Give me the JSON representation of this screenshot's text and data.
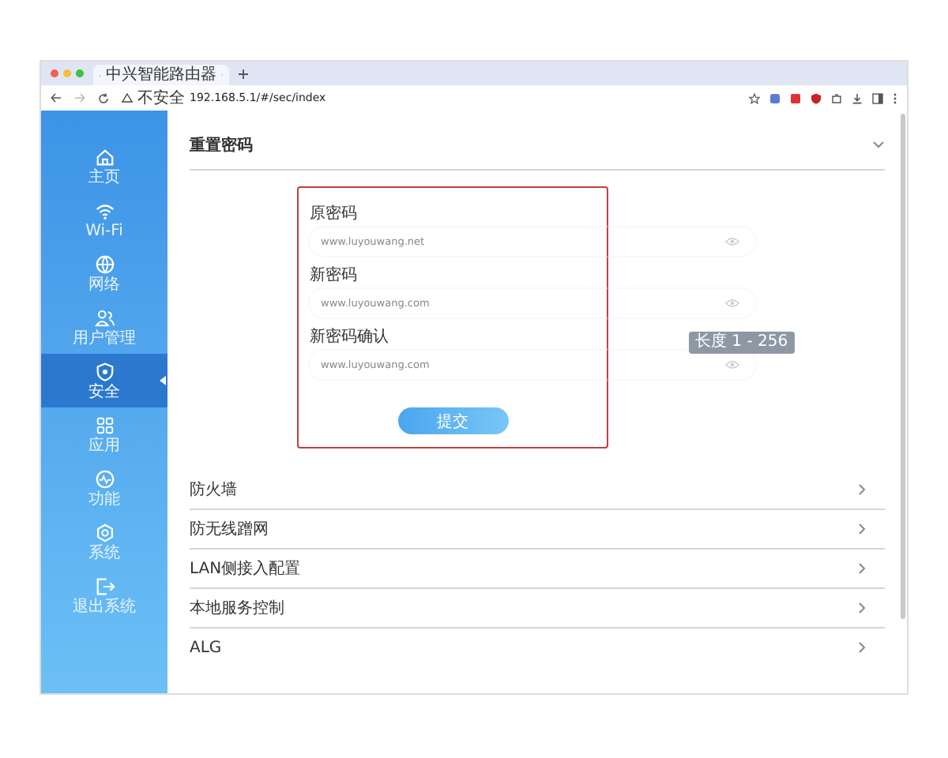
{
  "browser": {
    "tab_title": "中兴智能路由器",
    "security_label": "不安全",
    "url": "192.168.5.1/#/sec/index"
  },
  "sidebar": {
    "items": [
      {
        "label": "主页",
        "selected": false
      },
      {
        "label": "Wi-Fi",
        "selected": false
      },
      {
        "label": "网络",
        "selected": false
      },
      {
        "label": "用户管理",
        "selected": false
      },
      {
        "label": "安全",
        "selected": true
      },
      {
        "label": "应用",
        "selected": false
      },
      {
        "label": "功能",
        "selected": false
      },
      {
        "label": "系统",
        "selected": false
      },
      {
        "label": "退出系统",
        "selected": false
      }
    ]
  },
  "section": {
    "title": "重置密码",
    "expanded": true
  },
  "form": {
    "fields": [
      {
        "label": "原密码",
        "value": "www.luyouwang.net"
      },
      {
        "label": "新密码",
        "value": "www.luyouwang.com"
      },
      {
        "label": "新密码确认",
        "value": "www.luyouwang.com"
      }
    ],
    "tooltip": "长度 1 - 256",
    "submit": "提交"
  },
  "rows": [
    {
      "label": "防火墙"
    },
    {
      "label": "防无线蹭网"
    },
    {
      "label": "LAN侧接入配置"
    },
    {
      "label": "本地服务控制"
    },
    {
      "label": "ALG"
    }
  ]
}
